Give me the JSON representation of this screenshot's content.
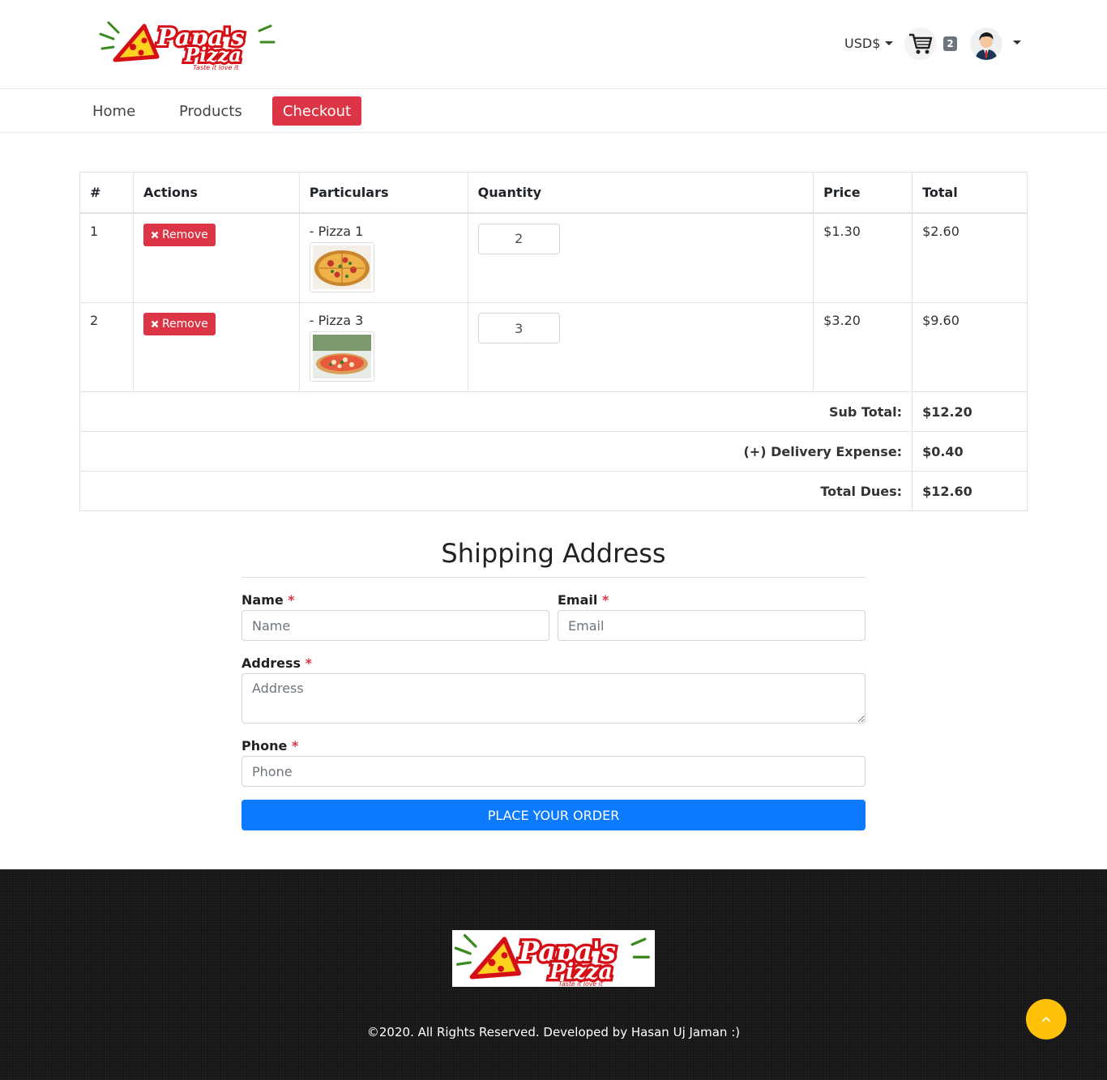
{
  "brand": {
    "name_line1": "Papa's",
    "name_line2": "Pizza",
    "tagline": "Taste it love it"
  },
  "header": {
    "currency": "USD$",
    "cart_count": "2"
  },
  "nav": {
    "home": "Home",
    "products": "Products",
    "checkout": "Checkout"
  },
  "table": {
    "headers": {
      "num": "#",
      "actions": "Actions",
      "particulars": "Particulars",
      "quantity": "Quantity",
      "price": "Price",
      "total": "Total"
    },
    "rows": [
      {
        "num": "1",
        "remove_label": "Remove",
        "product": "- Pizza 1",
        "quantity": "2",
        "price": "$1.30",
        "total": "$2.60"
      },
      {
        "num": "2",
        "remove_label": "Remove",
        "product": "- Pizza 3",
        "quantity": "3",
        "price": "$3.20",
        "total": "$9.60"
      }
    ],
    "subtotal_label": "Sub Total:",
    "subtotal_value": "$12.20",
    "delivery_label": "(+) Delivery Expense:",
    "delivery_value": "$0.40",
    "total_label": "Total Dues:",
    "total_value": "$12.60"
  },
  "shipping": {
    "title": "Shipping Address",
    "name_label": "Name",
    "name_placeholder": "Name",
    "email_label": "Email",
    "email_placeholder": "Email",
    "address_label": "Address",
    "address_placeholder": "Address",
    "phone_label": "Phone",
    "phone_placeholder": "Phone",
    "required_mark": "*",
    "submit": "PLACE YOUR ORDER"
  },
  "footer": {
    "copyright": "©2020. All Rights Reserved. Developed by Hasan Uj Jaman :)"
  },
  "colors": {
    "brand_red": "#dc3545",
    "primary_blue": "#0d7bff",
    "scroll_top_yellow": "#ffc107",
    "footer_bg": "#161616"
  },
  "icons": {
    "cart": "cart-icon",
    "avatar": "user-avatar",
    "remove": "times-icon",
    "scroll_top": "chevron-up-icon"
  }
}
